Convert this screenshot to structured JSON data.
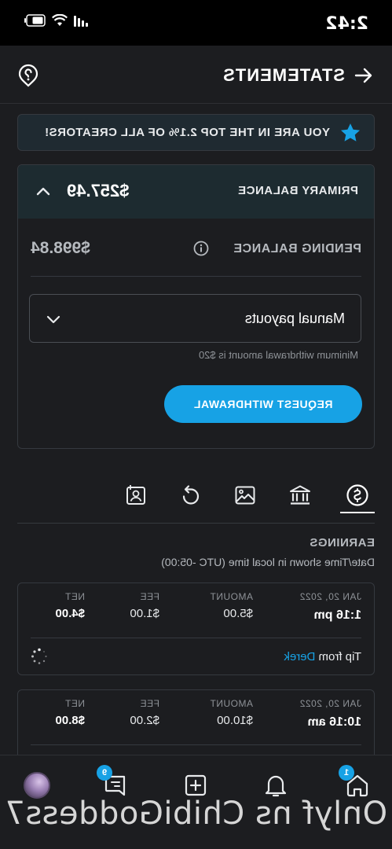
{
  "status_bar": {
    "time": "2:42"
  },
  "header": {
    "title": "STATEMENTS"
  },
  "rank_banner": {
    "text": "YOU ARE IN THE TOP 2.1% OF ALL CREATORS!"
  },
  "balance": {
    "primary_label": "PRIMARY BALANCE",
    "primary_value": "$257.49",
    "pending_label": "PENDING BALANCE",
    "pending_value": "$998.84",
    "payout_method": "Manual payouts",
    "min_withdrawal_note": "Minimum withdrawal amount is $20",
    "withdraw_button": "REQUEST WITHDRAWAL"
  },
  "tabs": [
    {
      "icon": "dollar-circle-icon",
      "active": true
    },
    {
      "icon": "bank-icon",
      "active": false
    },
    {
      "icon": "image-icon",
      "active": false
    },
    {
      "icon": "refresh-icon",
      "active": false
    },
    {
      "icon": "user-report-icon",
      "active": false
    }
  ],
  "earnings": {
    "title": "EARNINGS",
    "timezone_note": "Date/Time shown in local time (UTC -05:00)",
    "column_headers": {
      "amount": "AMOUNT",
      "fee": "FEE",
      "net": "NET"
    },
    "transactions": [
      {
        "date": "JAN 20, 2022",
        "time": "1:16 pm",
        "amount": "$5.00",
        "fee": "$1.00",
        "net": "$4.00",
        "desc_prefix": "Tip from",
        "desc_user": "Derek"
      },
      {
        "date": "JAN 20, 2022",
        "time": "10:16 am",
        "amount": "$10.00",
        "fee": "$2.00",
        "net": "$8.00"
      }
    ]
  },
  "bottom_nav": {
    "home_badge": "1",
    "messages_badge": "9"
  },
  "watermark": "Onlyf ns ChibiGoddess7",
  "colors": {
    "accent": "#17a2e5",
    "background": "#1c1d20",
    "banner": "#1f2a31"
  }
}
